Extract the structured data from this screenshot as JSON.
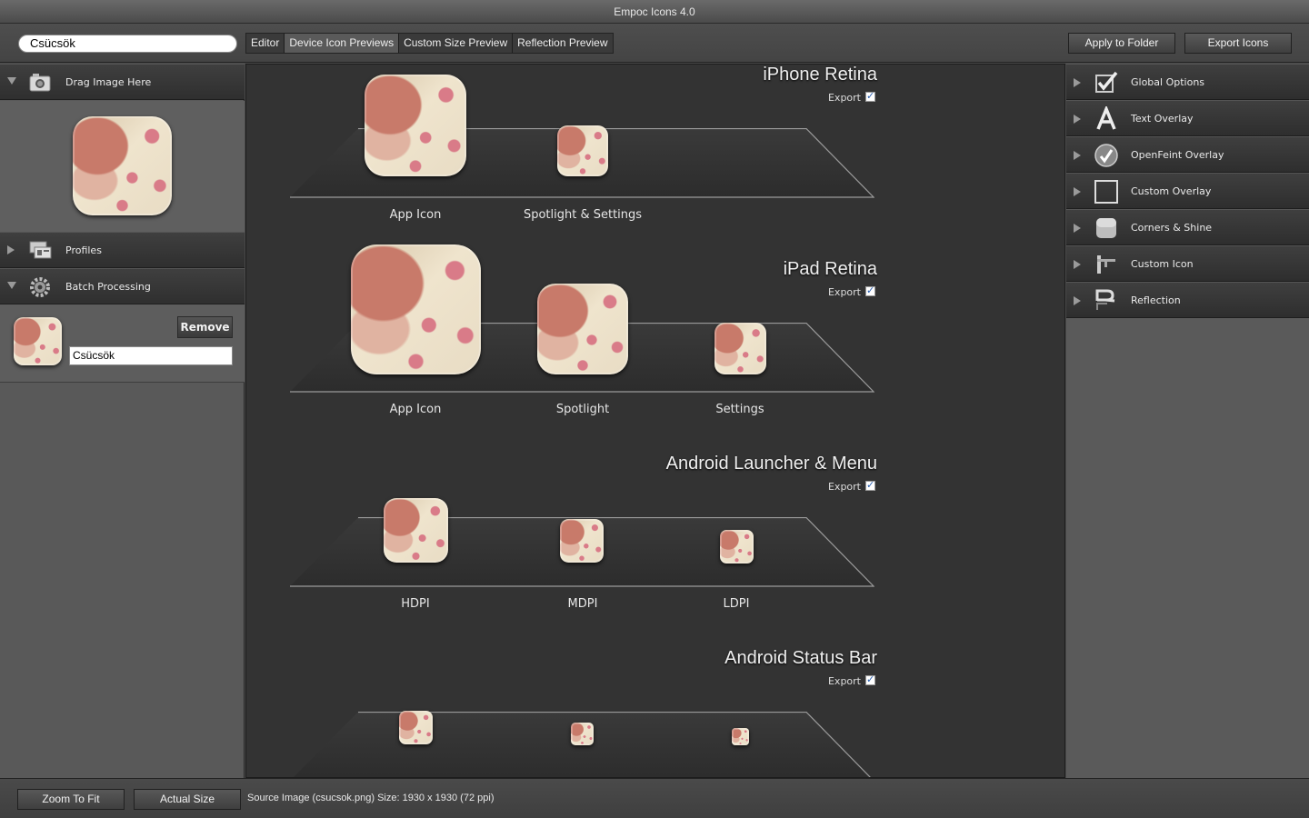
{
  "window": {
    "title": "Empoc Icons 4.0"
  },
  "toolbar": {
    "search_value": "Csücsök",
    "tabs": [
      {
        "label": "Editor",
        "active": false
      },
      {
        "label": "Device Icon Previews",
        "active": true
      },
      {
        "label": "Custom Size Preview",
        "active": false
      },
      {
        "label": "Reflection Preview",
        "active": false
      }
    ],
    "apply_label": "Apply to Folder",
    "export_label": "Export Icons"
  },
  "left_panel": {
    "drag": {
      "label": "Drag Image Here",
      "icon": "camera-icon"
    },
    "profiles": {
      "label": "Profiles",
      "icon": "profiles-icon"
    },
    "batch": {
      "label": "Batch Processing",
      "icon": "gear-icon"
    },
    "batch_item": {
      "remove_label": "Remove",
      "name_value": "Csücsök"
    }
  },
  "groups": [
    {
      "title": "iPhone Retina",
      "export_label": "Export",
      "export_checked": true,
      "items": [
        {
          "label": "App Icon"
        },
        {
          "label": "Spotlight & Settings"
        }
      ]
    },
    {
      "title": "iPad Retina",
      "export_label": "Export",
      "export_checked": true,
      "items": [
        {
          "label": "App Icon"
        },
        {
          "label": "Spotlight"
        },
        {
          "label": "Settings"
        }
      ]
    },
    {
      "title": "Android Launcher & Menu",
      "export_label": "Export",
      "export_checked": true,
      "items": [
        {
          "label": "HDPI"
        },
        {
          "label": "MDPI"
        },
        {
          "label": "LDPI"
        }
      ]
    },
    {
      "title": "Android Status Bar",
      "export_label": "Export",
      "export_checked": true,
      "items": []
    }
  ],
  "right_panel": {
    "items": [
      {
        "label": "Global Options",
        "icon": "checkmark-icon"
      },
      {
        "label": "Text Overlay",
        "icon": "letter-a-icon"
      },
      {
        "label": "OpenFeint Overlay",
        "icon": "openfeint-icon"
      },
      {
        "label": "Custom Overlay",
        "icon": "square-outline-icon"
      },
      {
        "label": "Corners & Shine",
        "icon": "rounded-square-icon"
      },
      {
        "label": "Custom Icon",
        "icon": "custom-icon-icon"
      },
      {
        "label": "Reflection",
        "icon": "reflection-icon"
      }
    ]
  },
  "bottom": {
    "zoom_fit_label": "Zoom To Fit",
    "actual_size_label": "Actual Size",
    "status": "Source Image (csucsok.png) Size: 1930 x 1930 (72 ppi)"
  }
}
